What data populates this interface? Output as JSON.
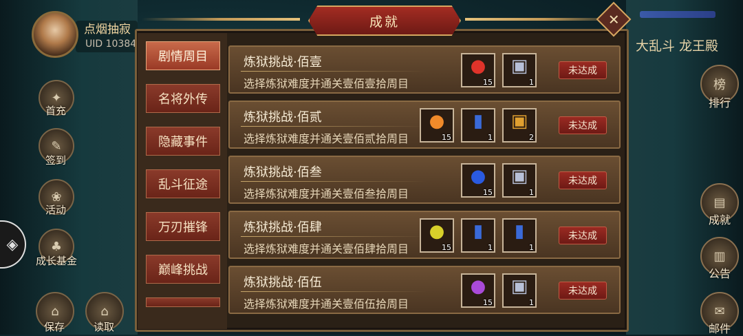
{
  "player": {
    "name": "点烟抽寂",
    "uid": "UID 10384"
  },
  "left_nav": [
    {
      "label": "首充",
      "icon": "gift-icon"
    },
    {
      "label": "签到",
      "icon": "brush-icon"
    },
    {
      "label": "活动",
      "icon": "activity-icon"
    },
    {
      "label": "成长基金",
      "icon": "tree-icon"
    },
    {
      "label": "保存",
      "icon": "save-icon"
    },
    {
      "label": "读取",
      "icon": "load-icon"
    }
  ],
  "right_nav": {
    "title": "大乱斗 龙王殿",
    "items": [
      {
        "label": "排行",
        "icon": "ranking-icon",
        "glyph": "榜"
      },
      {
        "label": "成就",
        "icon": "achievement-icon",
        "glyph": ""
      },
      {
        "label": "公告",
        "icon": "scroll-icon",
        "glyph": ""
      },
      {
        "label": "邮件",
        "icon": "mail-icon",
        "glyph": ""
      }
    ]
  },
  "panel": {
    "title": "成就",
    "close_glyph": "✕",
    "categories": [
      {
        "label": "剧情周目",
        "active": true
      },
      {
        "label": "名将外传",
        "active": false
      },
      {
        "label": "隐藏事件",
        "active": false
      },
      {
        "label": "乱斗征途",
        "active": false
      },
      {
        "label": "万刃摧锋",
        "active": false
      },
      {
        "label": "巅峰挑战",
        "active": false
      }
    ],
    "achievements": [
      {
        "title": "炼狱挑战·佰壹",
        "desc": "选择炼狱难度并通关壹佰壹拾周目",
        "status": "未达成",
        "rewards": [
          {
            "icon": "red-fruit-icon",
            "count": "15"
          },
          {
            "icon": "silver-chest-icon",
            "count": "1"
          }
        ]
      },
      {
        "title": "炼狱挑战·佰贰",
        "desc": "选择炼狱难度并通关壹佰贰拾周目",
        "status": "未达成",
        "rewards": [
          {
            "icon": "orange-fruit-icon",
            "count": "15"
          },
          {
            "icon": "blue-scroll-icon",
            "count": "1"
          },
          {
            "icon": "gold-chest-icon",
            "count": "2"
          }
        ]
      },
      {
        "title": "炼狱挑战·佰叁",
        "desc": "选择炼狱难度并通关壹佰叁拾周目",
        "status": "未达成",
        "rewards": [
          {
            "icon": "blue-fruit-icon",
            "count": "15"
          },
          {
            "icon": "silver-chest-icon",
            "count": "1"
          }
        ]
      },
      {
        "title": "炼狱挑战·佰肆",
        "desc": "选择炼狱难度并通关壹佰肆拾周目",
        "status": "未达成",
        "rewards": [
          {
            "icon": "yellow-fruit-icon",
            "count": "15"
          },
          {
            "icon": "blue-scroll-icon",
            "count": "1"
          },
          {
            "icon": "blue-scroll-icon",
            "count": "1"
          }
        ]
      },
      {
        "title": "炼狱挑战·佰伍",
        "desc": "选择炼狱难度并通关壹佰伍拾周目",
        "status": "未达成",
        "rewards": [
          {
            "icon": "purple-fruit-icon",
            "count": "15"
          },
          {
            "icon": "silver-chest-icon",
            "count": "1"
          }
        ]
      }
    ]
  }
}
